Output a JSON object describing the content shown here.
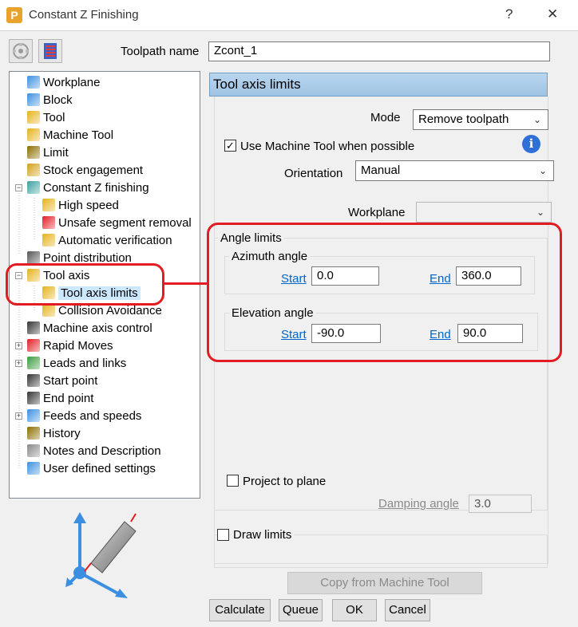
{
  "window": {
    "title": "Constant Z Finishing",
    "help_label": "?",
    "close_label": "✕"
  },
  "toolpath": {
    "name_label": "Toolpath name",
    "name_value": "Zcont_1"
  },
  "tree": {
    "items": [
      {
        "label": "Workplane",
        "icon": "workplane-icon"
      },
      {
        "label": "Block",
        "icon": "block-icon"
      },
      {
        "label": "Tool",
        "icon": "tool-icon"
      },
      {
        "label": "Machine Tool",
        "icon": "machine-tool-icon"
      },
      {
        "label": "Limit",
        "icon": "limit-icon"
      },
      {
        "label": "Stock engagement",
        "icon": "stock-engagement-icon"
      },
      {
        "label": "Constant Z finishing",
        "icon": "constant-z-icon",
        "expander": "−"
      },
      {
        "label": "High speed",
        "icon": "high-speed-icon"
      },
      {
        "label": "Unsafe segment removal",
        "icon": "unsafe-segment-icon"
      },
      {
        "label": "Automatic verification",
        "icon": "automatic-verification-icon"
      },
      {
        "label": "Point distribution",
        "icon": "point-distribution-icon"
      },
      {
        "label": "Tool axis",
        "icon": "tool-axis-icon",
        "expander": "−"
      },
      {
        "label": "Tool axis limits",
        "icon": "tool-axis-limits-icon",
        "selected": true
      },
      {
        "label": "Collision Avoidance",
        "icon": "collision-avoidance-icon"
      },
      {
        "label": "Machine axis control",
        "icon": "machine-axis-control-icon"
      },
      {
        "label": "Rapid Moves",
        "icon": "rapid-moves-icon",
        "expander": "+"
      },
      {
        "label": "Leads and links",
        "icon": "leads-links-icon",
        "expander": "+"
      },
      {
        "label": "Start point",
        "icon": "start-point-icon"
      },
      {
        "label": "End point",
        "icon": "end-point-icon"
      },
      {
        "label": "Feeds and speeds",
        "icon": "feeds-speeds-icon",
        "expander": "+"
      },
      {
        "label": "History",
        "icon": "history-icon"
      },
      {
        "label": "Notes and Description",
        "icon": "notes-icon"
      },
      {
        "label": "User defined settings",
        "icon": "user-settings-icon"
      }
    ]
  },
  "section": {
    "title": "Tool axis limits",
    "mode_label": "Mode",
    "mode_value": "Remove toolpath",
    "use_machine_tool_label": "Use Machine Tool when possible",
    "use_machine_tool_checked": true,
    "orientation_label": "Orientation",
    "orientation_value": "Manual",
    "workplane_label": "Workplane",
    "workplane_value": ""
  },
  "angle_limits": {
    "title": "Angle limits",
    "azimuth": {
      "title": "Azimuth angle",
      "start_label": "Start",
      "start_value": "0.0",
      "end_label": "End",
      "end_value": "360.0"
    },
    "elevation": {
      "title": "Elevation angle",
      "start_label": "Start",
      "start_value": "-90.0",
      "end_label": "End",
      "end_value": "90.0"
    }
  },
  "project": {
    "label": "Project to plane",
    "checked": false,
    "damping_label": "Damping angle",
    "damping_value": "3.0"
  },
  "draw_limits": {
    "label": "Draw limits",
    "checked": false
  },
  "buttons": {
    "copy_from_machine_tool": "Copy from Machine Tool",
    "calculate": "Calculate",
    "queue": "Queue",
    "ok": "OK",
    "cancel": "Cancel"
  },
  "colors": {
    "highlight": "#e31c23",
    "header_bg": "#b9d6ef",
    "link": "#0066cc"
  }
}
